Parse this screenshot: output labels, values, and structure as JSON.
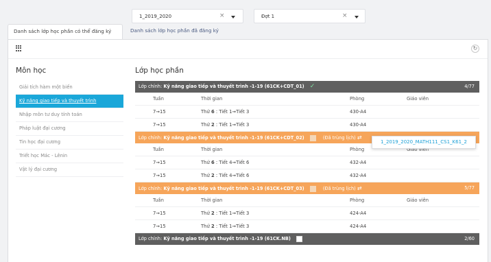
{
  "filters": {
    "year": "1_2019_2020",
    "term": "Đợt 1"
  },
  "tabs": [
    {
      "label": "Danh sách lớp học phần có thể đăng ký"
    },
    {
      "label": "Danh sách lớp học phần đã đăng ký"
    }
  ],
  "subjects": {
    "title": "Môn học",
    "items": [
      {
        "label": "Giải tích hàm một biến"
      },
      {
        "label": "Kỹ năng giao tiếp và thuyết trình"
      },
      {
        "label": "Nhập môn tư duy tính toán"
      },
      {
        "label": "Pháp luật đại cương"
      },
      {
        "label": "Tin học đại cương"
      },
      {
        "label": "Triết học Mác - Lênin"
      },
      {
        "label": "Vật lý đại cương"
      }
    ]
  },
  "classes": {
    "title": "Lớp học phần",
    "columns": {
      "week": "Tuần",
      "time": "Thời gian",
      "room": "Phòng",
      "teacher": "Giáo viên"
    },
    "groups": [
      {
        "prefix": "Lớp chính:",
        "name": "Kỹ năng giao tiếp và thuyết trình -1-19 (61CK+CDT_01)",
        "count": "4/77",
        "conflict": "",
        "rows": [
          {
            "week": "7➞15",
            "time_prefix": "Thứ ",
            "day": "6",
            "time_rest": " : Tiết 1➞Tiết 3",
            "room": "430-A4",
            "teacher": ""
          },
          {
            "week": "7➞15",
            "time_prefix": "Thứ ",
            "day": "2",
            "time_rest": " : Tiết 1➞Tiết 3",
            "room": "430-A4",
            "teacher": ""
          }
        ]
      },
      {
        "prefix": "Lớp chính:",
        "name": "Kỹ năng giao tiếp và thuyết trình -1-19 (61CK+CDT_02)",
        "count": "",
        "conflict": "(Đã trùng lịch)",
        "rows": [
          {
            "week": "7➞15",
            "time_prefix": "Thứ ",
            "day": "6",
            "time_rest": " : Tiết 4➞Tiết 6",
            "room": "432-A4",
            "teacher": ""
          },
          {
            "week": "7➞15",
            "time_prefix": "Thứ ",
            "day": "2",
            "time_rest": " : Tiết 4➞Tiết 6",
            "room": "432-A4",
            "teacher": ""
          }
        ]
      },
      {
        "prefix": "Lớp chính:",
        "name": "Kỹ năng giao tiếp và thuyết trình -1-19 (61CK+CDT_03)",
        "count": "5/77",
        "conflict": "(Đã trùng lịch)",
        "rows": [
          {
            "week": "7➞15",
            "time_prefix": "Thứ ",
            "day": "2",
            "time_rest": " : Tiết 1➞Tiết 3",
            "room": "424-A4",
            "teacher": ""
          },
          {
            "week": "7➞15",
            "time_prefix": "Thứ ",
            "day": "2",
            "time_rest": " : Tiết 1➞Tiết 3",
            "room": "424-A4",
            "teacher": ""
          }
        ]
      },
      {
        "prefix": "Lớp chính:",
        "name": "Kỹ năng giao tiếp và thuyết trình -1-19 (61CK.NB)",
        "count": "2/60",
        "conflict": "",
        "rows": []
      }
    ]
  },
  "tooltip": {
    "text": "1_2019_2020_MATH111_CS1_K61_2"
  }
}
